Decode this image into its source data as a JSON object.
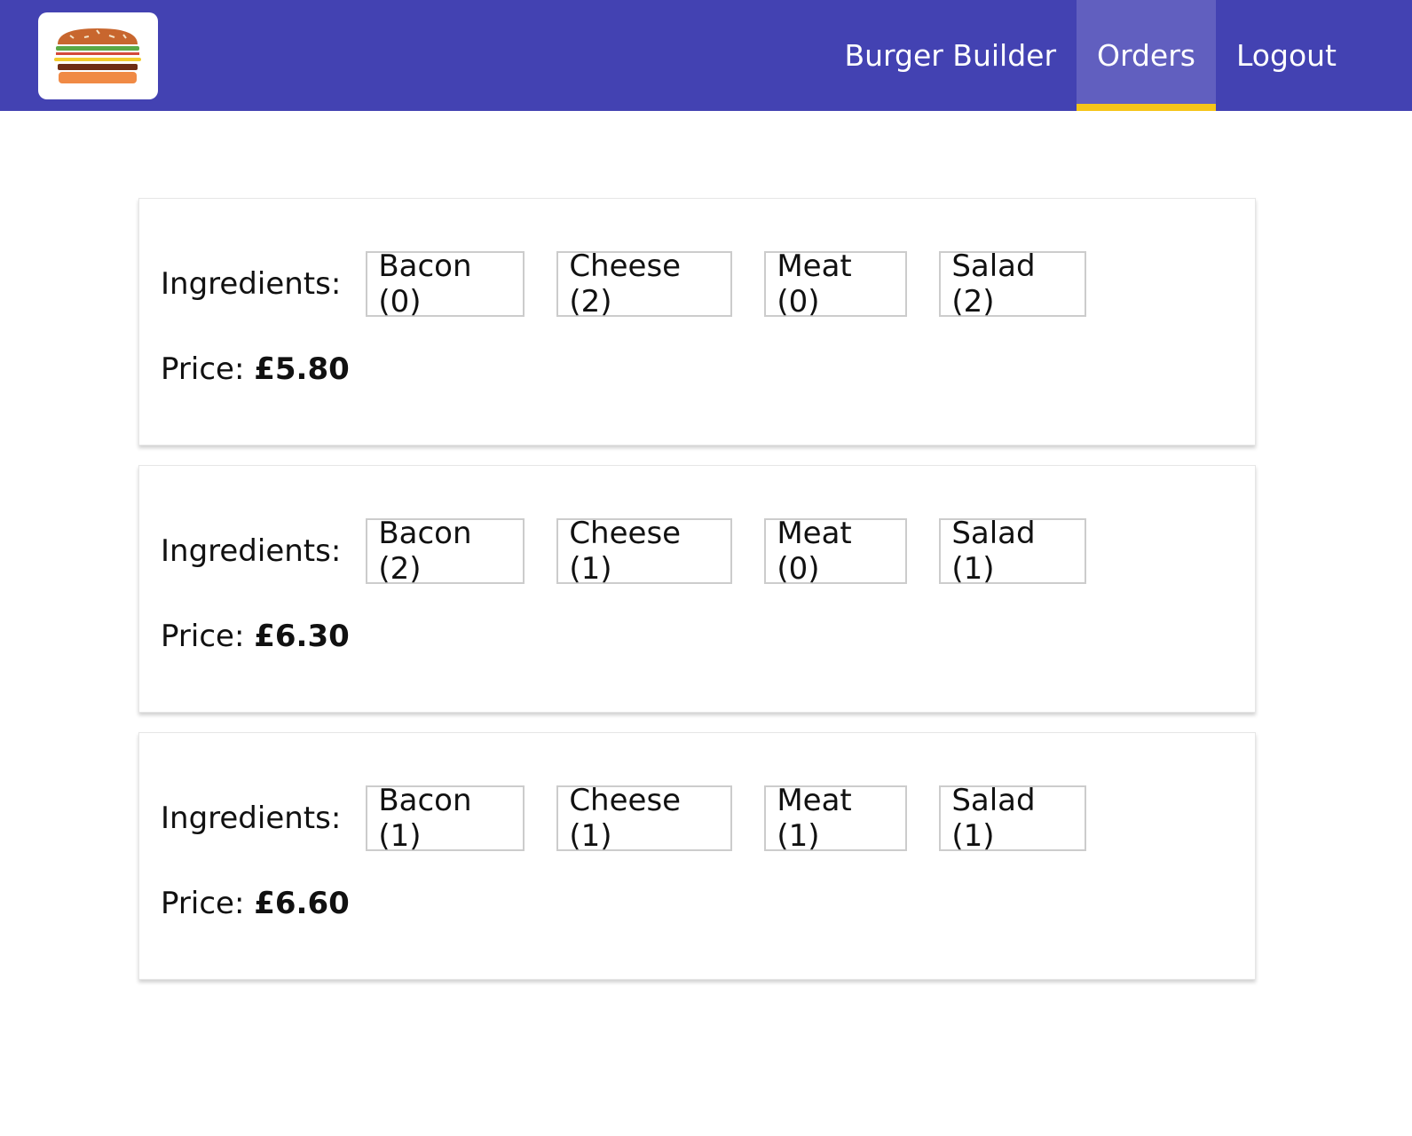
{
  "header": {
    "logo": "burger-logo",
    "nav": [
      {
        "label": "Burger Builder",
        "active": false
      },
      {
        "label": "Orders",
        "active": true
      },
      {
        "label": "Logout",
        "active": false
      }
    ],
    "colors": {
      "toolbar": "#4342b2",
      "active_tab": "#615fbf",
      "active_underline": "#f5c518"
    }
  },
  "orders": [
    {
      "ingredients_label": "Ingredients:",
      "ingredients": [
        "Bacon (0)",
        "Cheese (2)",
        "Meat (0)",
        "Salad (2)"
      ],
      "price_label": "Price:",
      "price": "£5.80"
    },
    {
      "ingredients_label": "Ingredients:",
      "ingredients": [
        "Bacon (2)",
        "Cheese (1)",
        "Meat (0)",
        "Salad (1)"
      ],
      "price_label": "Price:",
      "price": "£6.30"
    },
    {
      "ingredients_label": "Ingredients:",
      "ingredients": [
        "Bacon (1)",
        "Cheese (1)",
        "Meat (1)",
        "Salad (1)"
      ],
      "price_label": "Price:",
      "price": "£6.60"
    }
  ]
}
